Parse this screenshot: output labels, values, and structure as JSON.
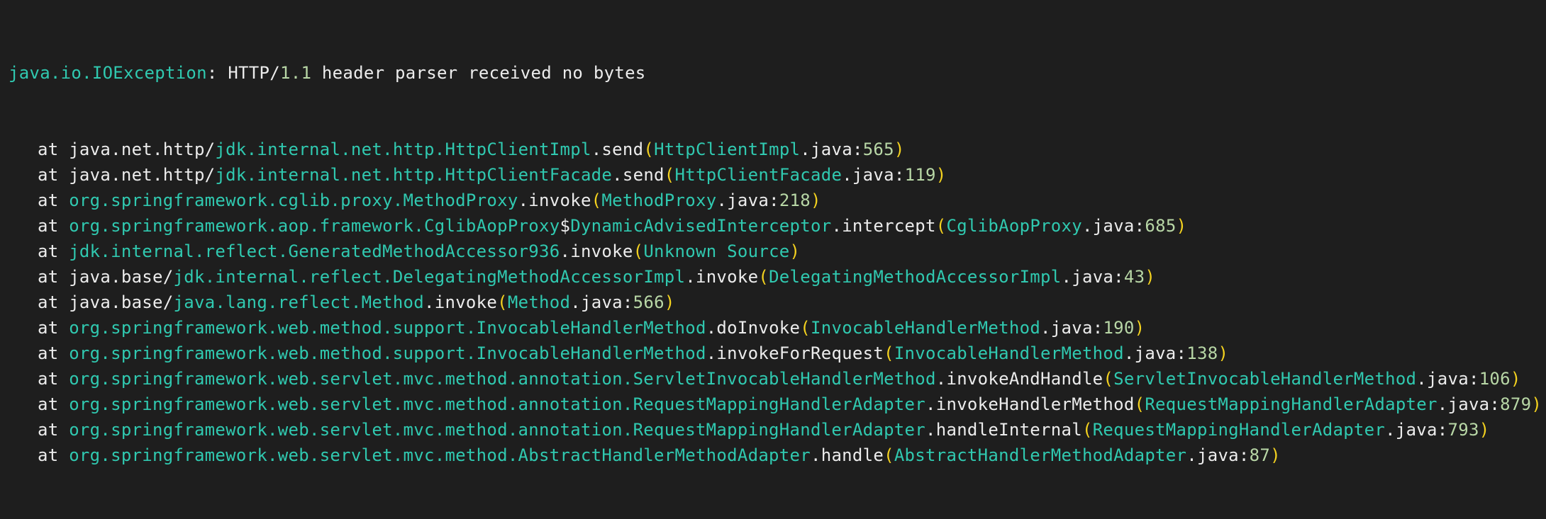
{
  "colors": {
    "background": "#1e1e1e",
    "text": "#ececec",
    "class_name": "#30c9b0",
    "number": "#b8d7a6",
    "paren": "#f4d21f"
  },
  "header": {
    "exception": "java.io.IOException",
    "colon": ":",
    "message_a": " HTTP/",
    "version": "1.1",
    "message_b": " header parser received no bytes"
  },
  "frames": [
    {
      "at": "at ",
      "module": "java.net.http/",
      "cls": "jdk.internal.net.http.HttpClientImpl",
      "method": ".send",
      "open": "(",
      "file": "HttpClientImpl",
      "ext": ".java:",
      "line": "565",
      "close": ")"
    },
    {
      "at": "at ",
      "module": "java.net.http/",
      "cls": "jdk.internal.net.http.HttpClientFacade",
      "method": ".send",
      "open": "(",
      "file": "HttpClientFacade",
      "ext": ".java:",
      "line": "119",
      "close": ")"
    },
    {
      "at": "at ",
      "cls": "org.springframework.cglib.proxy.MethodProxy",
      "method": ".invoke",
      "open": "(",
      "file": "MethodProxy",
      "ext": ".java:",
      "line": "218",
      "close": ")"
    },
    {
      "at": "at ",
      "cls": "org.springframework.aop.framework.CglibAopProxy",
      "dollar": "$",
      "inner": "DynamicAdvisedInterceptor",
      "method": ".intercept",
      "open": "(",
      "file": "CglibAopProxy",
      "ext": ".java:",
      "line": "685",
      "close": ")"
    },
    {
      "at": "at ",
      "cls": "jdk.internal.reflect.GeneratedMethodAccessor936",
      "method": ".invoke",
      "open": "(",
      "file": "Unknown Source",
      "close": ")"
    },
    {
      "at": "at ",
      "module": "java.base/",
      "cls": "jdk.internal.reflect.DelegatingMethodAccessorImpl",
      "method": ".invoke",
      "open": "(",
      "file": "DelegatingMethodAccessorImpl",
      "ext": ".java:",
      "line": "43",
      "close": ")"
    },
    {
      "at": "at ",
      "module": "java.base/",
      "cls": "java.lang.reflect.Method",
      "method": ".invoke",
      "open": "(",
      "file": "Method",
      "ext": ".java:",
      "line": "566",
      "close": ")"
    },
    {
      "at": "at ",
      "cls": "org.springframework.web.method.support.InvocableHandlerMethod",
      "method": ".doInvoke",
      "open": "(",
      "file": "InvocableHandlerMethod",
      "ext": ".java:",
      "line": "190",
      "close": ")"
    },
    {
      "at": "at ",
      "cls": "org.springframework.web.method.support.InvocableHandlerMethod",
      "method": ".invokeForRequest",
      "open": "(",
      "file": "InvocableHandlerMethod",
      "ext": ".java:",
      "line": "138",
      "close": ")"
    },
    {
      "at": "at ",
      "cls": "org.springframework.web.servlet.mvc.method.annotation.ServletInvocableHandlerMethod",
      "method": ".invokeAndHandle",
      "open": "(",
      "file": "ServletInvocableHandlerMethod",
      "ext": ".java:",
      "line": "106",
      "close": ")"
    },
    {
      "at": "at ",
      "cls": "org.springframework.web.servlet.mvc.method.annotation.RequestMappingHandlerAdapter",
      "method": ".invokeHandlerMethod",
      "open": "(",
      "file": "RequestMappingHandlerAdapter",
      "ext": ".java:",
      "line": "879",
      "close": ")"
    },
    {
      "at": "at ",
      "cls": "org.springframework.web.servlet.mvc.method.annotation.RequestMappingHandlerAdapter",
      "method": ".handleInternal",
      "open": "(",
      "file": "RequestMappingHandlerAdapter",
      "ext": ".java:",
      "line": "793",
      "close": ")"
    },
    {
      "at": "at ",
      "cls": "org.springframework.web.servlet.mvc.method.AbstractHandlerMethodAdapter",
      "method": ".handle",
      "open": "(",
      "file": "AbstractHandlerMethodAdapter",
      "ext": ".java:",
      "line": "87",
      "close": ")"
    }
  ]
}
